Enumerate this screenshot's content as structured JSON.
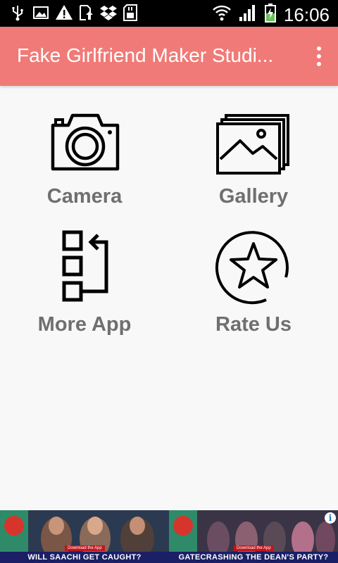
{
  "status_bar": {
    "time": "16:06",
    "left_icons": [
      "usb-icon",
      "image-icon",
      "warning-icon",
      "update-icon",
      "dropbox-icon",
      "sd-card-icon"
    ],
    "right_icons": [
      "wifi-icon",
      "signal-icon",
      "battery-charging-icon"
    ]
  },
  "app_bar": {
    "title": "Fake Girlfriend Maker Studi...",
    "color": "#f07a77",
    "menu_icon": "more-vert-icon"
  },
  "tiles": [
    {
      "label": "Camera",
      "icon": "camera-icon"
    },
    {
      "label": "Gallery",
      "icon": "gallery-icon"
    },
    {
      "label": "More App",
      "icon": "more-apps-icon"
    },
    {
      "label": "Rate Us",
      "icon": "star-icon"
    }
  ],
  "ad": {
    "left_caption": "WILL SAACHI GET CAUGHT?",
    "right_caption": "GATECRASHING THE DEAN'S PARTY?",
    "download_label": "Download the App",
    "info_label": "i"
  }
}
